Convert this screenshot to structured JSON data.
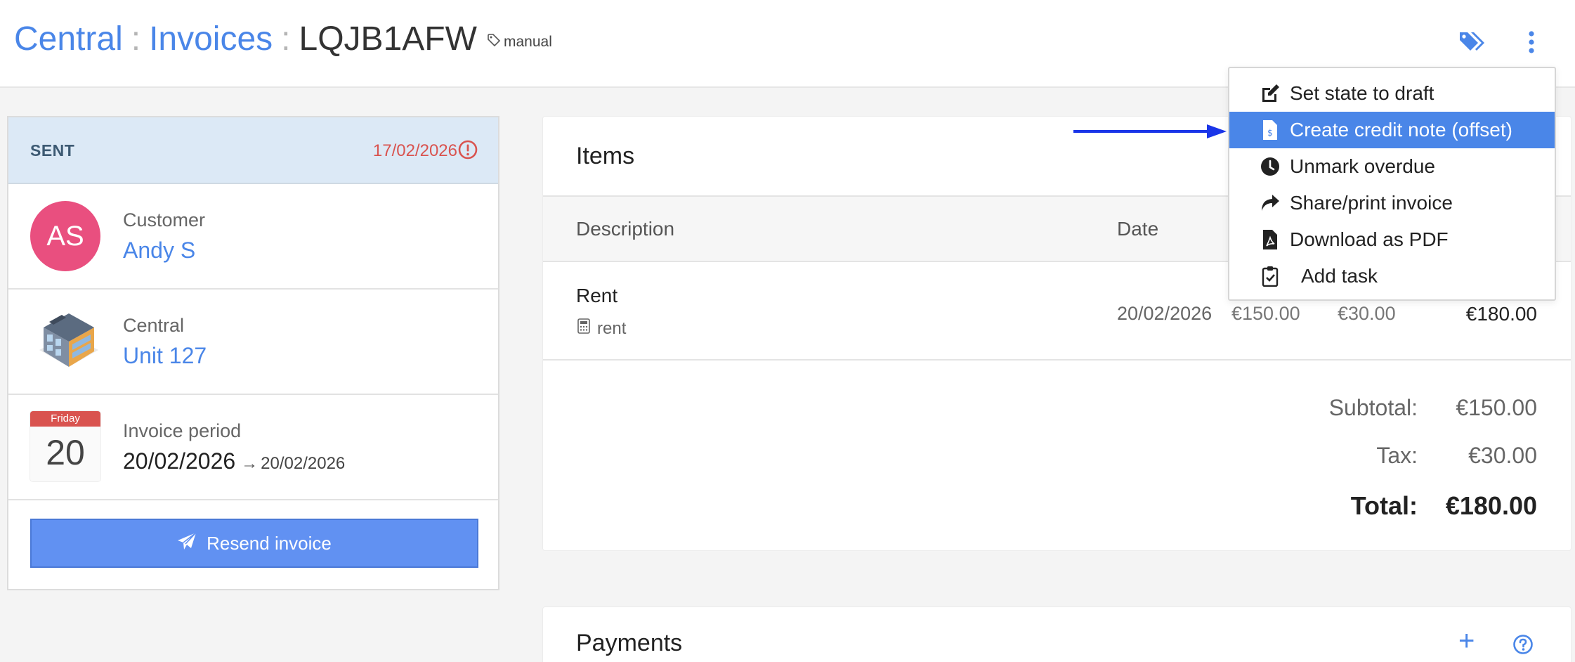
{
  "breadcrumb": {
    "items": [
      "Central",
      "Invoices"
    ],
    "current": "LQJB1AFW",
    "separator": ":"
  },
  "header": {
    "tag_label": "manual",
    "tag_icon": "tags-icon",
    "menu_icon": "kebab-menu-icon"
  },
  "status": {
    "label": "SENT",
    "due_date": "17/02/2026",
    "alert_icon": "exclamation-circle-icon",
    "bar_color": "#dce9f6",
    "due_color": "#d9534f"
  },
  "customer": {
    "initials": "AS",
    "label": "Customer",
    "name": "Andy S",
    "avatar_color": "#e94f7f"
  },
  "property": {
    "label": "Central",
    "unit": "Unit 127"
  },
  "period": {
    "label": "Invoice period",
    "weekday": "Friday",
    "day": "20",
    "start": "20/02/2026",
    "arrow": "→",
    "end": "20/02/2026"
  },
  "resend_label": "Resend invoice",
  "items_card": {
    "title": "Items",
    "columns": {
      "description": "Description",
      "date": "Date"
    },
    "rows": [
      {
        "name": "Rent",
        "category": "rent",
        "date": "20/02/2026",
        "net": "€150.00",
        "tax": "€30.00",
        "total": "€180.00"
      }
    ],
    "subtotal_label": "Subtotal:",
    "subtotal_value": "€150.00",
    "tax_label": "Tax:",
    "tax_value": "€30.00",
    "total_label": "Total:",
    "total_value": "€180.00"
  },
  "payments": {
    "title": "Payments",
    "add": "+",
    "help_icon": "question-circle-icon"
  },
  "dropdown": {
    "items": [
      {
        "label": "Set state to draft",
        "icon": "edit-icon",
        "active": false
      },
      {
        "label": "Create credit note (offset)",
        "icon": "file-invoice-dollar-icon",
        "active": true
      },
      {
        "label": "Unmark overdue",
        "icon": "clock-icon",
        "active": false
      },
      {
        "label": "Share/print invoice",
        "icon": "share-icon",
        "active": false
      },
      {
        "label": "Download as PDF",
        "icon": "pdf-file-icon",
        "active": false
      },
      {
        "label": "Add task",
        "icon": "clipboard-check-icon",
        "active": false
      }
    ]
  },
  "colors": {
    "accent": "#4a86e8",
    "button": "#6191f2",
    "annotation_arrow": "#1a35e8"
  }
}
